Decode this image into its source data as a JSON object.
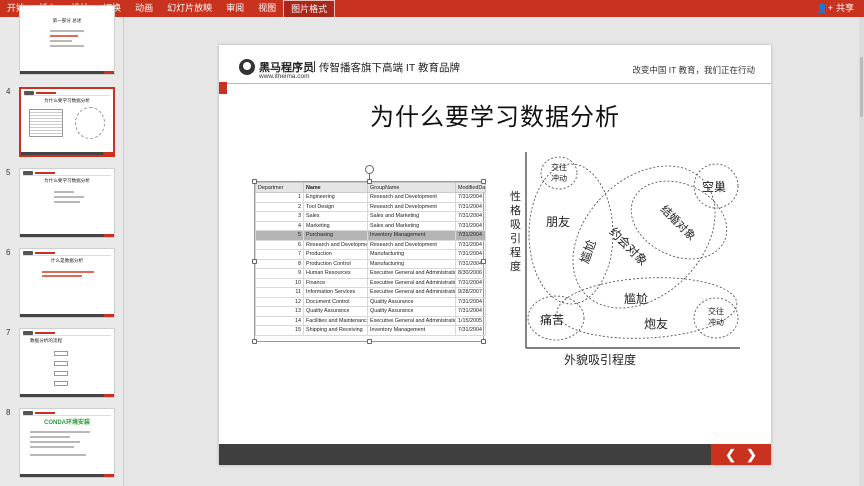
{
  "ribbon": {
    "tabs": [
      "开始",
      "插入",
      "设计",
      "切换",
      "动画",
      "幻灯片放映",
      "审阅",
      "视图",
      "图片格式"
    ],
    "active_tab": "图片格式",
    "share_label": "共享"
  },
  "thumbnails": [
    {
      "number": "",
      "title": "第一部分  总述"
    },
    {
      "number": "4",
      "title": "为什么要学习数据分析"
    },
    {
      "number": "5",
      "title": "为什么要学习数据分析"
    },
    {
      "number": "6",
      "title": "什么是数据分析"
    },
    {
      "number": "7",
      "title": "数据分析的流程"
    },
    {
      "number": "8",
      "title": "CONDA环境安装"
    }
  ],
  "slide": {
    "brand_name": "黑马程序员",
    "brand_url": "www.itheima.com",
    "brand_tagline": "传智播客旗下高端 IT 教育品牌",
    "motto": "改变中国 IT 教育，我们正在行动",
    "title": "为什么要学习数据分析",
    "nav_prev": "❮",
    "nav_next": "❯"
  },
  "grid": {
    "columns": [
      "Departmer",
      "Name",
      "GroupName",
      "ModifiedDa"
    ],
    "rows": [
      [
        "1",
        "Engineering",
        "Research and Development",
        "7/31/2004"
      ],
      [
        "2",
        "Tool Design",
        "Research and Development",
        "7/31/2004"
      ],
      [
        "3",
        "Sales",
        "Sales and Marketing",
        "7/31/2004"
      ],
      [
        "4",
        "Marketing",
        "Sales and Marketing",
        "7/31/2004"
      ],
      [
        "5",
        "Purchasing",
        "Inventory Management",
        "7/31/2004"
      ],
      [
        "6",
        "Research and Development",
        "Research and Development",
        "7/31/2004"
      ],
      [
        "7",
        "Production",
        "Manufacturing",
        "7/31/2004"
      ],
      [
        "8",
        "Production Control",
        "Manufacturing",
        "7/31/2004"
      ],
      [
        "9",
        "Human Resources",
        "Executive General and Administration",
        "8/30/2006"
      ],
      [
        "10",
        "Finance",
        "Executive General and Administration",
        "7/31/2004"
      ],
      [
        "11",
        "Information Services",
        "Executive General and Administration",
        "9/28/2007"
      ],
      [
        "12",
        "Document Control",
        "Quality Assurance",
        "7/31/2004"
      ],
      [
        "13",
        "Quality Assurance",
        "Quality Assurance",
        "7/31/2004"
      ],
      [
        "14",
        "Facilities and Maintenance",
        "Executive General and Administration",
        "1/15/2005"
      ],
      [
        "15",
        "Shipping and Receiving",
        "Inventory Management",
        "7/31/2004"
      ]
    ],
    "highlighted_row": 4
  },
  "venn": {
    "y_axis": "性格吸引程度",
    "x_axis": "外貌吸引程度",
    "labels": {
      "top_left_small": [
        "交往",
        "冲动"
      ],
      "friends": "朋友",
      "awkward_v": "尴尬",
      "date_target": "约会对象",
      "marriage_target": "结婚对象",
      "spare": "空巢",
      "awkward_h": "尴尬",
      "pain": "痛苦",
      "fwb": "炮友",
      "bottom_right_small": [
        "交往",
        "冲动"
      ]
    }
  }
}
